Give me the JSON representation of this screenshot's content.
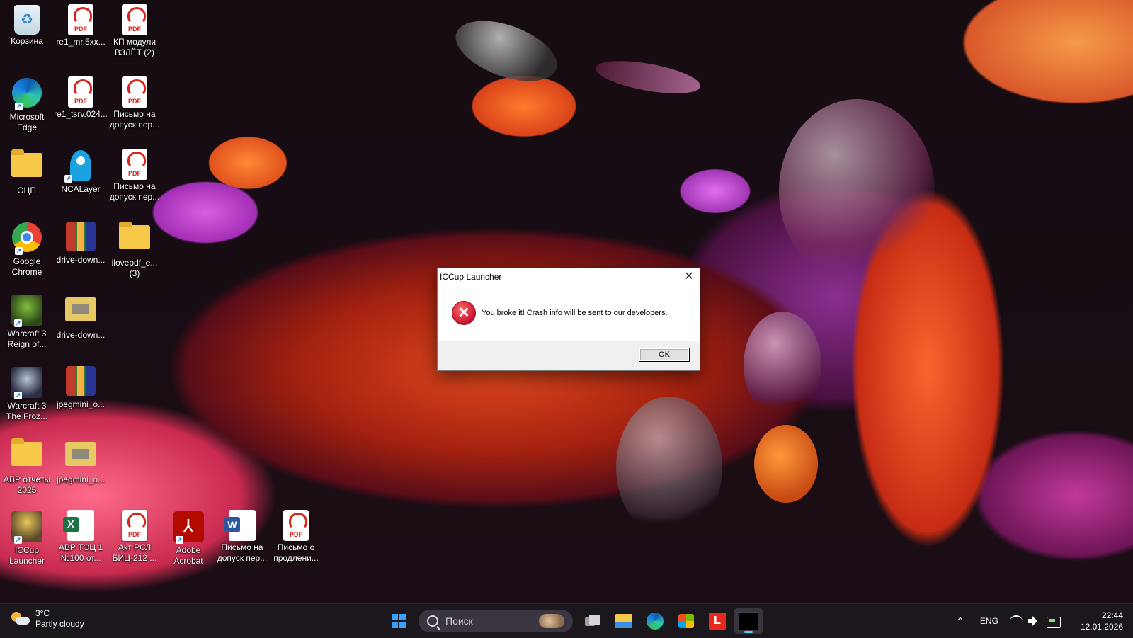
{
  "desktop": {
    "icons": [
      {
        "label": "Корзина",
        "icon": "recycle-bin-icon"
      },
      {
        "label": "re1_mr.5xx...",
        "icon": "pdf-file-icon",
        "tag": "PDF"
      },
      {
        "label": "КП модули ВЗЛЁТ (2)",
        "icon": "pdf-file-icon",
        "tag": "PDF"
      },
      {
        "label": "Microsoft Edge",
        "icon": "edge-icon"
      },
      {
        "label": "re1_tsrv.024...",
        "icon": "pdf-file-icon",
        "tag": "PDF"
      },
      {
        "label": "Письмо на допуск пер...",
        "icon": "pdf-file-icon",
        "tag": "PDF"
      },
      {
        "label": "ЭЦП",
        "icon": "folder-icon"
      },
      {
        "label": "NCALayer",
        "icon": "ncalayer-icon"
      },
      {
        "label": "Письмо на допуск пер...",
        "icon": "pdf-file-icon",
        "tag": "PDF"
      },
      {
        "label": "Google Chrome",
        "icon": "chrome-icon"
      },
      {
        "label": "drive-down...",
        "icon": "winrar-archive-icon"
      },
      {
        "label": "ilovepdf_e... (3)",
        "icon": "folder-icon"
      },
      {
        "label": "Warcraft 3 Reign of...",
        "icon": "warcraft-reign-icon"
      },
      {
        "label": "drive-down...",
        "icon": "zip-folder-icon"
      },
      {
        "label": "Warcraft 3 The Froz...",
        "icon": "warcraft-frozen-throne-icon"
      },
      {
        "label": "jpegmini_o...",
        "icon": "winrar-archive-icon"
      },
      {
        "label": "АВР отчеты 2025",
        "icon": "folder-icon"
      },
      {
        "label": "jpegmini_o...",
        "icon": "zip-folder-icon"
      },
      {
        "label": "ICCup Launcher",
        "icon": "iccup-launcher-icon"
      },
      {
        "label": "АВР ТЭЦ 1 №100 от...",
        "icon": "excel-file-icon"
      },
      {
        "label": "Акт РСЛ БИЦ-212 ...",
        "icon": "pdf-file-icon",
        "tag": "PDF"
      },
      {
        "label": "Adobe Acrobat",
        "icon": "acrobat-icon"
      },
      {
        "label": "Письмо на допуск пер...",
        "icon": "word-file-icon"
      },
      {
        "label": "Письмо о продлени...",
        "icon": "pdf-file-icon",
        "tag": "PDF"
      }
    ]
  },
  "dialog": {
    "title": "ICCup Launcher",
    "close_glyph": "✕",
    "error_glyph": "✕",
    "message": "You broke it! Crash info will be sent to our developers.",
    "ok_label": "OK"
  },
  "taskbar": {
    "weather": {
      "temp": "3°C",
      "condition": "Partly cloudy"
    },
    "search_placeholder": "Поиск",
    "apps": [
      "start-button",
      "search",
      "task-view",
      "file-explorer",
      "edge",
      "microsoft-store",
      "l-app",
      "terminal-app"
    ],
    "active_app": "terminal-app",
    "tray": {
      "chevron": "^",
      "language": "ENG"
    },
    "clock": {
      "time": "22:44",
      "date": "12.01.2026"
    }
  },
  "colors": {
    "accent": "#60cdff",
    "error_red": "#c8102e",
    "taskbar_bg": "#1c181e"
  }
}
